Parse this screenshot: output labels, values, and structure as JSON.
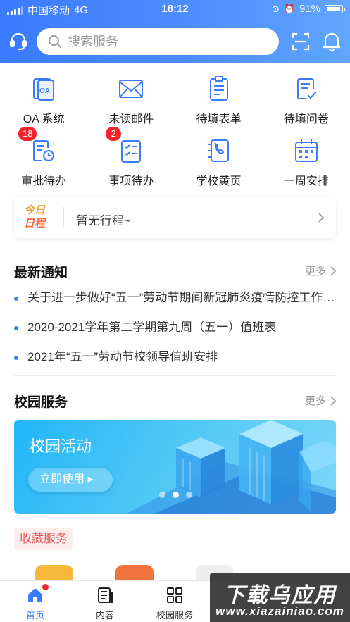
{
  "status_bar": {
    "carrier": "中国移动",
    "network": "4G",
    "time": "18:12",
    "battery": "91%"
  },
  "header": {
    "search_placeholder": "搜索服务",
    "icons": [
      "headset-icon",
      "scan-icon",
      "bell-icon"
    ]
  },
  "apps": [
    {
      "label": "OA 系统",
      "icon": "oa-icon",
      "badge": ""
    },
    {
      "label": "未读邮件",
      "icon": "mail-icon",
      "badge": ""
    },
    {
      "label": "待填表单",
      "icon": "form-icon",
      "badge": ""
    },
    {
      "label": "待填问卷",
      "icon": "survey-icon",
      "badge": ""
    },
    {
      "label": "审批待办",
      "icon": "approval-icon",
      "badge": "18"
    },
    {
      "label": "事项待办",
      "icon": "todo-icon",
      "badge": "2"
    },
    {
      "label": "学校黄页",
      "icon": "phonebook-icon",
      "badge": ""
    },
    {
      "label": "一周安排",
      "icon": "calendar-icon",
      "badge": ""
    }
  ],
  "schedule": {
    "title_line1": "今日",
    "title_line2": "日程",
    "text": "暂无行程~"
  },
  "notices": {
    "title": "最新通知",
    "more": "更多",
    "items": [
      "关于进一步做好“五一”劳动节期间新冠肺炎疫情防控工作的通知",
      "2020-2021学年第二学期第九周（五一）值班表",
      "2021年“五一”劳动节校领导值班安排"
    ]
  },
  "campus": {
    "title": "校园服务",
    "more": "更多",
    "banner": {
      "title": "校园活动",
      "button": "立即使用 ▸",
      "dots": 3,
      "active_dot": 1
    }
  },
  "favorites": {
    "label": "收藏服务",
    "tile_colors": [
      "#f6b93b",
      "#f0733f",
      "#eeeeee"
    ]
  },
  "tabbar": {
    "tabs": [
      {
        "label": "首页",
        "icon": "home-icon",
        "active": true
      },
      {
        "label": "内容",
        "icon": "content-icon",
        "active": false
      },
      {
        "label": "校园服务",
        "icon": "grid-icon",
        "active": false
      }
    ]
  },
  "watermark": {
    "line1": "下载乌应用",
    "line2": "www.xiazainiao.com"
  },
  "colors": {
    "brand": "#3a7bff",
    "badge": "#f5222d"
  }
}
